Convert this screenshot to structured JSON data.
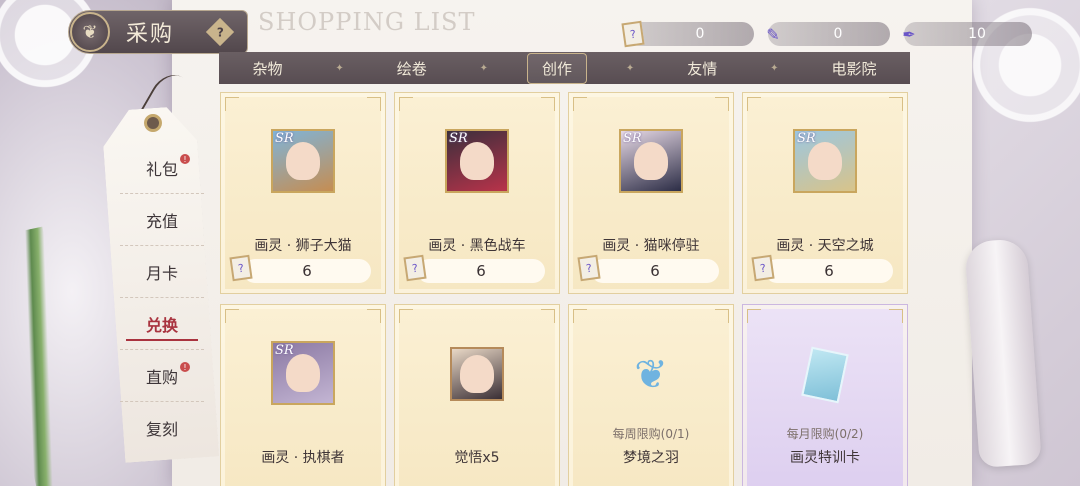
{
  "header": {
    "title": "采购",
    "help_label": "?",
    "watermark": "SHOPPING LIST"
  },
  "currencies": [
    {
      "icon": "ticket-icon",
      "value": "0"
    },
    {
      "icon": "paintbrush-card-icon",
      "value": "0"
    },
    {
      "icon": "quill-icon",
      "value": "10"
    }
  ],
  "tabs": [
    {
      "label": "杂物",
      "active": false
    },
    {
      "label": "绘卷",
      "active": false
    },
    {
      "label": "创作",
      "active": true
    },
    {
      "label": "友情",
      "active": false
    },
    {
      "label": "电影院",
      "active": false
    }
  ],
  "sidebar": {
    "items": [
      {
        "label": "礼包",
        "badge": true,
        "active": false
      },
      {
        "label": "充值",
        "badge": false,
        "active": false
      },
      {
        "label": "月卡",
        "badge": false,
        "active": false
      },
      {
        "label": "兑换",
        "badge": false,
        "active": true
      },
      {
        "label": "直购",
        "badge": true,
        "active": false
      },
      {
        "label": "复刻",
        "badge": false,
        "active": false
      }
    ]
  },
  "items": [
    {
      "name": "画灵 · 狮子大猫",
      "price": "6",
      "rarity": "SR",
      "limit": ""
    },
    {
      "name": "画灵 · 黑色战车",
      "price": "6",
      "rarity": "SR",
      "limit": ""
    },
    {
      "name": "画灵 · 猫咪停驻",
      "price": "6",
      "rarity": "SR",
      "limit": ""
    },
    {
      "name": "画灵 · 天空之城",
      "price": "6",
      "rarity": "SR",
      "limit": ""
    },
    {
      "name": "画灵 · 执棋者",
      "price": "",
      "rarity": "SR",
      "limit": ""
    },
    {
      "name": "觉悟x5",
      "price": "",
      "rarity": "",
      "limit": ""
    },
    {
      "name": "梦境之羽",
      "price": "",
      "rarity": "",
      "limit": "每周限购(0/1)"
    },
    {
      "name": "画灵特训卡",
      "price": "",
      "rarity": "",
      "limit": "每月限购(0/2)"
    }
  ],
  "colors": {
    "tab_bar": "#584d52",
    "active_menu": "#a9333f",
    "card_gold": "#f6e7c2",
    "card_purple": "#dccdef"
  }
}
